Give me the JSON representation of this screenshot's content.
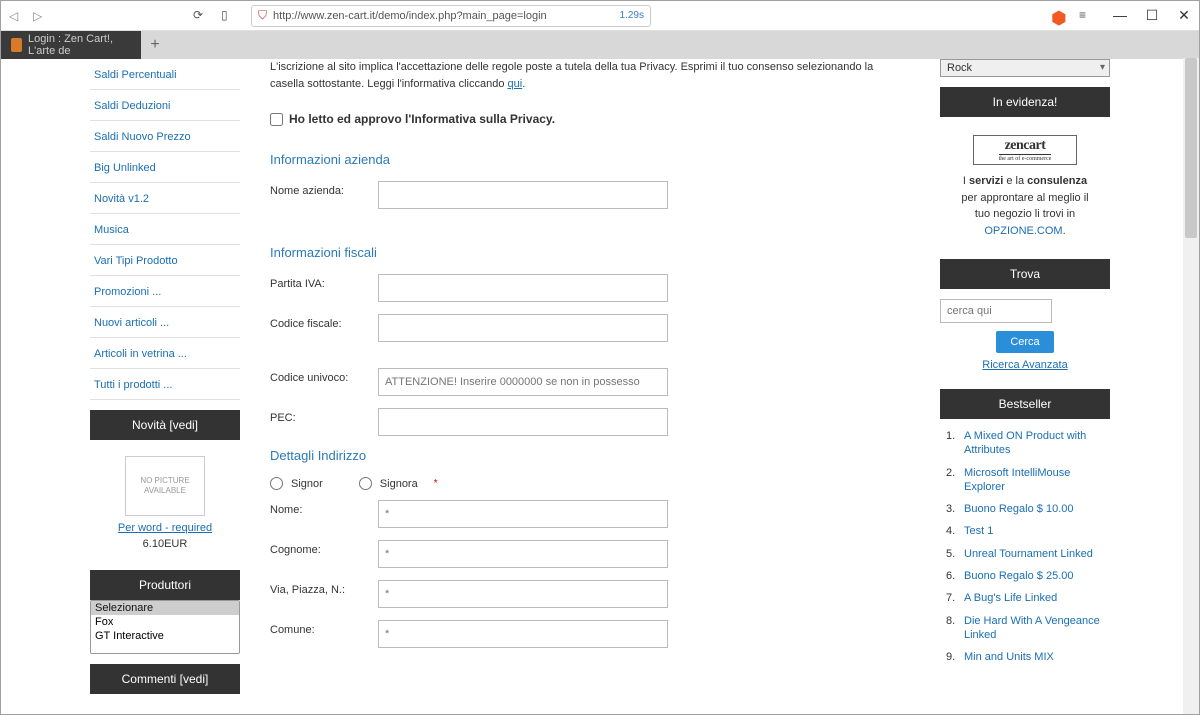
{
  "browser": {
    "url": "http://www.zen-cart.it/demo/index.php?main_page=login",
    "loadtime": "1.29s",
    "tab_title": "Login : Zen Cart!, L'arte de"
  },
  "sidebar_left": {
    "categories": [
      "Saldi Percentuali",
      "Saldi Deduzioni",
      "Saldi Nuovo Prezzo",
      "Big Unlinked",
      "Novità v1.2",
      "Musica",
      "Vari Tipi Prodotto",
      "Promozioni ...",
      "Nuovi articoli ...",
      "Articoli in vetrina ...",
      "Tutti i prodotti ..."
    ],
    "novita_header": "Novità  [vedi]",
    "nopic_text": "NO PICTURE AVAILABLE",
    "product_link": "Per word - required",
    "product_price": "6.10EUR",
    "produttori_header": "Produttori",
    "produttori_options": [
      "Selezionare",
      "Fox",
      "GT Interactive"
    ],
    "commenti_header": "Commenti  [vedi]"
  },
  "form": {
    "privacy_note_1": "L'iscrizione al sito implica l'accettazione delle regole poste a tutela della tua Privacy. Esprimi il tuo consenso selezionando la casella sottostante. Leggi l'informativa cliccando ",
    "privacy_note_link": "qui",
    "privacy_chk_label": "Ho letto ed approvo l'Informativa sulla Privacy.",
    "sec_azienda": "Informazioni azienda",
    "lbl_nome_azienda": "Nome azienda:",
    "sec_fiscali": "Informazioni fiscali",
    "lbl_piva": "Partita IVA:",
    "lbl_cf": "Codice fiscale:",
    "lbl_cu": "Codice univoco:",
    "ph_cu": "ATTENZIONE! Inserire 0000000 se non in possesso",
    "lbl_pec": "PEC:",
    "sec_indirizzo": "Dettagli Indirizzo",
    "r_signor": "Signor",
    "r_signora": "Signora",
    "lbl_nome": "Nome:",
    "lbl_cognome": "Cognome:",
    "lbl_via": "Via, Piazza, N.:",
    "lbl_comune": "Comune:",
    "req_mark": "*"
  },
  "sidebar_right": {
    "dd_value": "Rock",
    "evidenza_header": "In evidenza!",
    "zc_l1": "zencart",
    "zc_l2": "the art of e-commerce",
    "promo_p1a": "I ",
    "promo_p1b": "servizi",
    "promo_p1c": " e la ",
    "promo_p1d": "consulenza",
    "promo_p2": "per approntare al meglio il",
    "promo_p3": "tuo negozio li trovi in",
    "promo_link": "OPZIONE.COM",
    "trova_header": "Trova",
    "search_ph": "cerca qui",
    "btn_cerca": "Cerca",
    "adv_search": "Ricerca Avanzata",
    "bestseller_header": "Bestseller",
    "bestsellers": [
      "A Mixed ON Product with Attributes",
      "Microsoft IntelliMouse Explorer",
      "Buono Regalo $ 10.00",
      "Test 1",
      "Unreal Tournament Linked",
      "Buono Regalo $ 25.00",
      "A Bug's Life Linked",
      "Die Hard With A Vengeance Linked",
      "Min and Units MIX"
    ]
  }
}
